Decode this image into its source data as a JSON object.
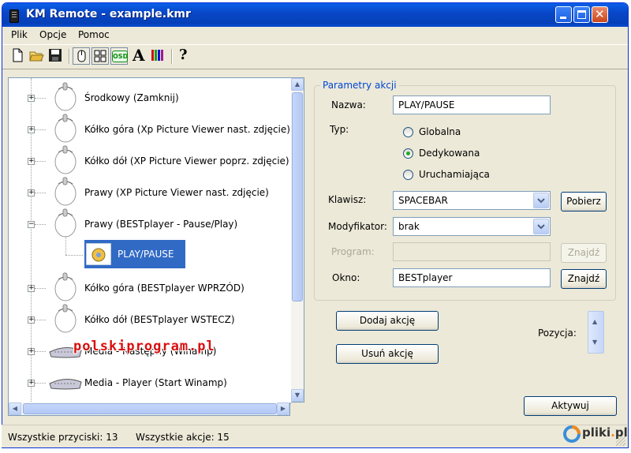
{
  "window": {
    "title": "KM Remote - example.kmr"
  },
  "menu": [
    {
      "label": "Plik"
    },
    {
      "label": "Opcje"
    },
    {
      "label": "Pomoc"
    }
  ],
  "toolbar": {
    "tools": [
      "new-file-icon",
      "open-folder-icon",
      "save-icon",
      "mouse-mode-icon",
      "grid-icon",
      "osd-icon",
      "font-icon",
      "colors-icon",
      "help-icon"
    ],
    "osd_label": "OSD",
    "font_label": "A",
    "help_label": "?"
  },
  "tree": {
    "items": [
      {
        "label": "Środkowy (Zamknij)",
        "icon": "mouse-icon",
        "expander": "+"
      },
      {
        "label": "Kółko góra (Xp Picture Viewer nast. zdjęcie)",
        "icon": "mouse-icon",
        "expander": "+"
      },
      {
        "label": "Kółko dół (XP Picture Viewer poprz. zdjęcie)",
        "icon": "mouse-icon",
        "expander": "+"
      },
      {
        "label": "Prawy (XP Picture Viewer nast. zdjęcie)",
        "icon": "mouse-icon",
        "expander": "+"
      },
      {
        "label": "Prawy (BESTplayer - Pause/Play)",
        "icon": "mouse-icon",
        "expander": "−"
      },
      {
        "label": "PLAY/PAUSE",
        "icon": "action-icon",
        "selected": true
      },
      {
        "label": "Kółko góra (BESTplayer WPRZÓD)",
        "icon": "mouse-icon",
        "expander": "+"
      },
      {
        "label": "Kółko dół (BESTplayer WSTECZ)",
        "icon": "mouse-icon",
        "expander": "+"
      },
      {
        "label": "Media - Następny (Winamp)",
        "icon": "keyboard-icon",
        "expander": "+"
      },
      {
        "label": "Media - Player (Start Winamp)",
        "icon": "keyboard-icon",
        "expander": "+"
      }
    ]
  },
  "panel": {
    "group_title": "Parametry akcji",
    "name_label": "Nazwa:",
    "name_value": "PLAY/PAUSE",
    "type_label": "Typ:",
    "radios": [
      {
        "label": "Globalna",
        "checked": false
      },
      {
        "label": "Dedykowana",
        "checked": true
      },
      {
        "label": "Uruchamiająca",
        "checked": false
      }
    ],
    "key_label": "Klawisz:",
    "key_value": "SPACEBAR",
    "get_button": "Pobierz",
    "modifier_label": "Modyfikator:",
    "modifier_value": "brak",
    "program_label": "Program:",
    "program_value": "",
    "find_button": "Znajdź",
    "window_label": "Okno:",
    "window_value": "BESTplayer"
  },
  "actions": {
    "add_button": "Dodaj akcję",
    "remove_button": "Usuń akcję",
    "position_label": "Pozycja:",
    "activate_button": "Aktywuj"
  },
  "status": {
    "buttons": "Wszystkie przyciski: 13",
    "actions": "Wszystkie akcje: 15"
  },
  "watermark": "polskiprogram.pl",
  "logo": {
    "text_main": "pliki",
    "text_dot": ".",
    "text_tld": "pl"
  }
}
